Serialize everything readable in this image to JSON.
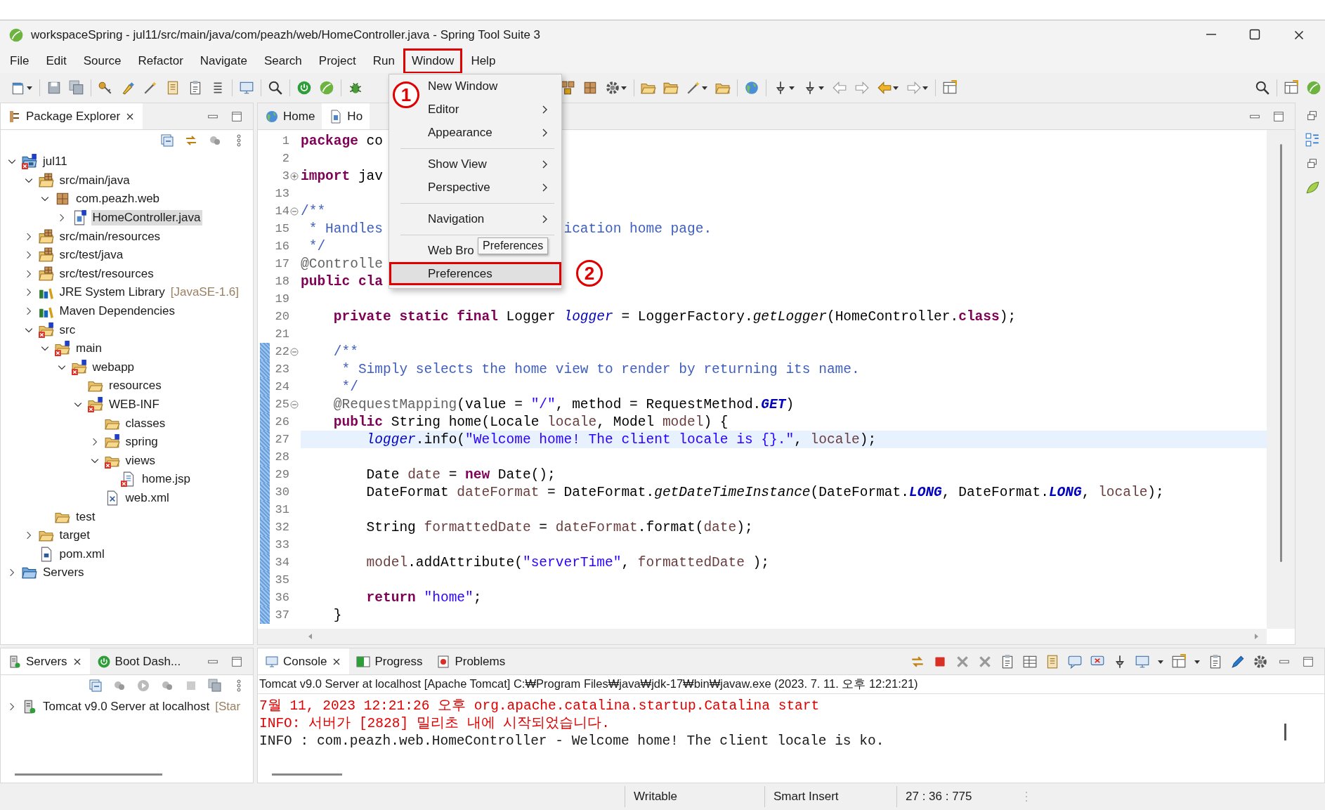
{
  "window": {
    "title": "workspaceSpring - jul11/src/main/java/com/peazh/web/HomeController.java - Spring Tool Suite 3"
  },
  "menu_bar": [
    {
      "label": "File",
      "selected": false
    },
    {
      "label": "Edit",
      "selected": false
    },
    {
      "label": "Source",
      "selected": false
    },
    {
      "label": "Refactor",
      "selected": false
    },
    {
      "label": "Navigate",
      "selected": false
    },
    {
      "label": "Search",
      "selected": false
    },
    {
      "label": "Project",
      "selected": false
    },
    {
      "label": "Run",
      "selected": false
    },
    {
      "label": "Window",
      "selected": true
    },
    {
      "label": "Help",
      "selected": false
    }
  ],
  "window_menu": {
    "items": [
      {
        "kind": "item",
        "label": "New Window",
        "submenu": false,
        "selected": false
      },
      {
        "kind": "item",
        "label": "Editor",
        "submenu": true,
        "selected": false
      },
      {
        "kind": "item",
        "label": "Appearance",
        "submenu": true,
        "selected": false
      },
      {
        "kind": "separator"
      },
      {
        "kind": "item",
        "label": "Show View",
        "submenu": true,
        "selected": false
      },
      {
        "kind": "item",
        "label": "Perspective",
        "submenu": true,
        "selected": false
      },
      {
        "kind": "separator"
      },
      {
        "kind": "item",
        "label": "Navigation",
        "submenu": true,
        "selected": false
      },
      {
        "kind": "separator"
      },
      {
        "kind": "item",
        "label": "Web Bro",
        "selected": false
      },
      {
        "kind": "item",
        "label": "Preferences",
        "submenu": false,
        "selected": true
      }
    ],
    "tooltip": "Preferences"
  },
  "callouts": [
    "1",
    "2"
  ],
  "package_explorer": {
    "tab": {
      "label": "Package Explorer",
      "closable": true
    },
    "tree": [
      {
        "label": "jul11",
        "kind": "project",
        "expanded": true,
        "selected": false,
        "error": true,
        "spring": true,
        "children": [
          {
            "label": "src/main/java",
            "kind": "source-folder",
            "expanded": true,
            "selected": false,
            "error": false,
            "spring": false,
            "children": [
              {
                "label": "com.peazh.web",
                "kind": "package",
                "expanded": true,
                "selected": false,
                "error": false,
                "spring": false,
                "children": [
                  {
                    "label": "HomeController.java",
                    "kind": "java-file",
                    "expanded": false,
                    "selected": true,
                    "error": false,
                    "spring": true
                  }
                ]
              }
            ]
          },
          {
            "label": "src/main/resources",
            "kind": "source-folder",
            "expanded": false,
            "selected": false,
            "error": false,
            "spring": false
          },
          {
            "label": "src/test/java",
            "kind": "source-folder",
            "expanded": false,
            "selected": false,
            "error": false,
            "spring": false
          },
          {
            "label": "src/test/resources",
            "kind": "source-folder",
            "expanded": false,
            "selected": false,
            "error": false,
            "spring": false
          },
          {
            "label": "JRE System Library",
            "decoration": "[JavaSE-1.6]",
            "kind": "library",
            "expanded": false,
            "selected": false,
            "error": false,
            "spring": false
          },
          {
            "label": "Maven Dependencies",
            "kind": "library",
            "expanded": false,
            "selected": false,
            "error": false,
            "spring": false
          },
          {
            "label": "src",
            "kind": "folder",
            "expanded": true,
            "selected": false,
            "error": true,
            "spring": true,
            "children": [
              {
                "label": "main",
                "kind": "folder",
                "expanded": true,
                "selected": false,
                "error": true,
                "spring": true,
                "children": [
                  {
                    "label": "webapp",
                    "kind": "folder",
                    "expanded": true,
                    "selected": false,
                    "error": true,
                    "spring": true,
                    "children": [
                      {
                        "label": "resources",
                        "kind": "folder",
                        "selected": false,
                        "error": false,
                        "spring": false
                      },
                      {
                        "label": "WEB-INF",
                        "kind": "folder",
                        "expanded": true,
                        "selected": false,
                        "error": true,
                        "spring": true,
                        "children": [
                          {
                            "label": "classes",
                            "kind": "folder",
                            "selected": false,
                            "error": false,
                            "spring": false
                          },
                          {
                            "label": "spring",
                            "kind": "folder",
                            "expanded": false,
                            "selected": false,
                            "error": false,
                            "spring": true
                          },
                          {
                            "label": "views",
                            "kind": "folder",
                            "expanded": true,
                            "selected": false,
                            "error": true,
                            "spring": false,
                            "children": [
                              {
                                "label": "home.jsp",
                                "kind": "jsp-file",
                                "selected": false,
                                "error": true,
                                "spring": false
                              }
                            ]
                          },
                          {
                            "label": "web.xml",
                            "kind": "xml-file",
                            "selected": false,
                            "error": false,
                            "spring": false
                          }
                        ]
                      }
                    ]
                  }
                ]
              },
              {
                "label": "test",
                "kind": "folder",
                "selected": false,
                "error": false,
                "spring": false
              }
            ]
          },
          {
            "label": "target",
            "kind": "folder",
            "expanded": false,
            "selected": false,
            "error": false,
            "spring": false
          },
          {
            "label": "pom.xml",
            "kind": "pom-file",
            "selected": false,
            "error": false,
            "spring": false
          }
        ]
      },
      {
        "label": "Servers",
        "kind": "server-folder",
        "expanded": false,
        "selected": false,
        "error": false,
        "spring": false
      }
    ]
  },
  "editor": {
    "tabs": [
      {
        "label": "Home",
        "kind": "browser",
        "selected": false
      },
      {
        "label": "Ho",
        "kind": "java",
        "selected": true
      }
    ],
    "lines": [
      {
        "number": "1",
        "tokens": [
          {
            "text": "package",
            "kind": "keyword"
          },
          {
            "text": " co",
            "kind": "plain"
          }
        ],
        "changed": false,
        "current": false
      },
      {
        "number": "2",
        "changed": false,
        "current": false
      },
      {
        "number": "3",
        "folded": true,
        "tokens": [
          {
            "text": "import",
            "kind": "keyword"
          },
          {
            "text": " jav",
            "kind": "plain"
          }
        ],
        "changed": false,
        "current": false
      },
      {
        "number": "13",
        "changed": false,
        "current": false
      },
      {
        "number": "14",
        "folded": false,
        "tokens": [
          {
            "text": "/**",
            "kind": "comment"
          }
        ],
        "changed": false,
        "current": false
      },
      {
        "number": "15",
        "tokens": [
          {
            "text": " * Handles",
            "kind": "comment"
          }
        ],
        "after_menu": [
          {
            "text": "ication home page.",
            "kind": "comment"
          }
        ],
        "changed": false,
        "current": false
      },
      {
        "number": "16",
        "tokens": [
          {
            "text": " */",
            "kind": "comment"
          }
        ],
        "changed": false,
        "current": false
      },
      {
        "number": "17",
        "tokens": [
          {
            "text": "@Controlle",
            "kind": "annotation"
          }
        ],
        "changed": false,
        "current": false
      },
      {
        "number": "18",
        "tokens": [
          {
            "text": "public cla",
            "kind": "keyword"
          }
        ],
        "changed": false,
        "current": false
      },
      {
        "number": "19",
        "changed": false,
        "current": false
      },
      {
        "number": "20",
        "tokens": [
          {
            "text": "    private static final",
            "kind": "keyword"
          },
          {
            "text": " Logger ",
            "kind": "plain"
          },
          {
            "text": "logger",
            "kind": "field"
          },
          {
            "text": " = LoggerFactory.",
            "kind": "plain"
          },
          {
            "text": "getLogger",
            "kind": "method"
          },
          {
            "text": "(HomeController.",
            "kind": "plain"
          },
          {
            "text": "class",
            "kind": "keyword"
          },
          {
            "text": ");",
            "kind": "plain"
          }
        ],
        "changed": false,
        "current": false
      },
      {
        "number": "21",
        "changed": false,
        "current": false
      },
      {
        "number": "22",
        "folded": false,
        "tokens": [
          {
            "text": "    /**",
            "kind": "comment"
          }
        ],
        "changed": true,
        "current": false
      },
      {
        "number": "23",
        "tokens": [
          {
            "text": "     * Simply selects the home view to render by returning its name.",
            "kind": "comment"
          }
        ],
        "changed": true,
        "current": false
      },
      {
        "number": "24",
        "tokens": [
          {
            "text": "     */",
            "kind": "comment"
          }
        ],
        "changed": true,
        "current": false
      },
      {
        "number": "25",
        "folded": false,
        "tokens": [
          {
            "text": "    @RequestMapping",
            "kind": "annotation"
          },
          {
            "text": "(value = ",
            "kind": "plain"
          },
          {
            "text": "\"/\"",
            "kind": "string"
          },
          {
            "text": ", method = RequestMethod.",
            "kind": "plain"
          },
          {
            "text": "GET",
            "kind": "constant"
          },
          {
            "text": ")",
            "kind": "plain"
          }
        ],
        "changed": true,
        "current": false
      },
      {
        "number": "26",
        "tokens": [
          {
            "text": "    public",
            "kind": "keyword"
          },
          {
            "text": " String home(Locale ",
            "kind": "plain"
          },
          {
            "text": "locale",
            "kind": "variable"
          },
          {
            "text": ", Model ",
            "kind": "plain"
          },
          {
            "text": "model",
            "kind": "variable"
          },
          {
            "text": ") {",
            "kind": "plain"
          }
        ],
        "changed": true,
        "current": false
      },
      {
        "number": "27",
        "tokens": [
          {
            "text": "        logger",
            "kind": "field"
          },
          {
            "text": ".info(",
            "kind": "plain"
          },
          {
            "text": "\"Welcome home! The client locale is {}.\"",
            "kind": "string"
          },
          {
            "text": ", ",
            "kind": "plain"
          },
          {
            "text": "locale",
            "kind": "variable"
          },
          {
            "text": ");",
            "kind": "plain"
          }
        ],
        "changed": true,
        "current": true
      },
      {
        "number": "28",
        "changed": true,
        "current": false
      },
      {
        "number": "29",
        "tokens": [
          {
            "text": "        Date ",
            "kind": "plain"
          },
          {
            "text": "date",
            "kind": "variable"
          },
          {
            "text": " = ",
            "kind": "plain"
          },
          {
            "text": "new",
            "kind": "keyword"
          },
          {
            "text": " Date();",
            "kind": "plain"
          }
        ],
        "changed": true,
        "current": false
      },
      {
        "number": "30",
        "tokens": [
          {
            "text": "        DateFormat ",
            "kind": "plain"
          },
          {
            "text": "dateFormat",
            "kind": "variable"
          },
          {
            "text": " = DateFormat.",
            "kind": "plain"
          },
          {
            "text": "getDateTimeInstance",
            "kind": "method"
          },
          {
            "text": "(DateFormat.",
            "kind": "plain"
          },
          {
            "text": "LONG",
            "kind": "constant"
          },
          {
            "text": ", DateFormat.",
            "kind": "plain"
          },
          {
            "text": "LONG",
            "kind": "constant"
          },
          {
            "text": ", ",
            "kind": "plain"
          },
          {
            "text": "locale",
            "kind": "variable"
          },
          {
            "text": ");",
            "kind": "plain"
          }
        ],
        "changed": true,
        "current": false
      },
      {
        "number": "31",
        "changed": true,
        "current": false
      },
      {
        "number": "32",
        "tokens": [
          {
            "text": "        String ",
            "kind": "plain"
          },
          {
            "text": "formattedDate",
            "kind": "variable"
          },
          {
            "text": " = ",
            "kind": "plain"
          },
          {
            "text": "dateFormat",
            "kind": "variable"
          },
          {
            "text": ".format(",
            "kind": "plain"
          },
          {
            "text": "date",
            "kind": "variable"
          },
          {
            "text": ");",
            "kind": "plain"
          }
        ],
        "changed": true,
        "current": false
      },
      {
        "number": "33",
        "changed": true,
        "current": false
      },
      {
        "number": "34",
        "tokens": [
          {
            "text": "        model",
            "kind": "variable"
          },
          {
            "text": ".addAttribute(",
            "kind": "plain"
          },
          {
            "text": "\"serverTime\"",
            "kind": "string"
          },
          {
            "text": ", ",
            "kind": "plain"
          },
          {
            "text": "formattedDate",
            "kind": "variable"
          },
          {
            "text": " );",
            "kind": "plain"
          }
        ],
        "changed": true,
        "current": false
      },
      {
        "number": "35",
        "changed": true,
        "current": false
      },
      {
        "number": "36",
        "tokens": [
          {
            "text": "        return",
            "kind": "keyword"
          },
          {
            "text": " \"home\"",
            "kind": "string"
          },
          {
            "text": ";",
            "kind": "plain"
          }
        ],
        "changed": true,
        "current": false
      },
      {
        "number": "37",
        "tokens": [
          {
            "text": "    }",
            "kind": "plain"
          }
        ],
        "changed": true,
        "current": false
      }
    ]
  },
  "servers_view": {
    "tabs": [
      {
        "label": "Servers",
        "kind": "servers",
        "closable": true,
        "selected": true
      },
      {
        "label": "Boot Dash...",
        "kind": "boot",
        "closable": false,
        "selected": false
      }
    ],
    "tree": [
      {
        "label": "Tomcat v9.0 Server at localhost",
        "decoration": "[Star",
        "kind": "server",
        "expanded": false,
        "selected": false,
        "error": false,
        "spring": false
      }
    ]
  },
  "console_view": {
    "tabs": [
      {
        "label": "Console",
        "kind": "console",
        "closable": true,
        "selected": true
      },
      {
        "label": "Progress",
        "kind": "progress",
        "closable": false,
        "selected": false
      },
      {
        "label": "Problems",
        "kind": "problems",
        "closable": false,
        "selected": false
      }
    ],
    "header": "Tomcat v9.0 Server at localhost [Apache Tomcat] C:₩Program Files₩java₩jdk-17₩bin₩javaw.exe  (2023. 7. 11. 오후 12:21:21)",
    "lines": [
      {
        "text": "7월 11, 2023 12:21:26 오후 org.apache.catalina.startup.Catalina start",
        "error": true
      },
      {
        "text": "INFO: 서버가 [2828] 밀리초 내에 시작되었습니다.",
        "error": true
      },
      {
        "text": "INFO : com.peazh.web.HomeController - Welcome home! The client locale is ko.",
        "error": false
      }
    ]
  },
  "status_bar": {
    "writable": "Writable",
    "insert_mode": "Smart Insert",
    "position": "27 : 36 : 775"
  }
}
